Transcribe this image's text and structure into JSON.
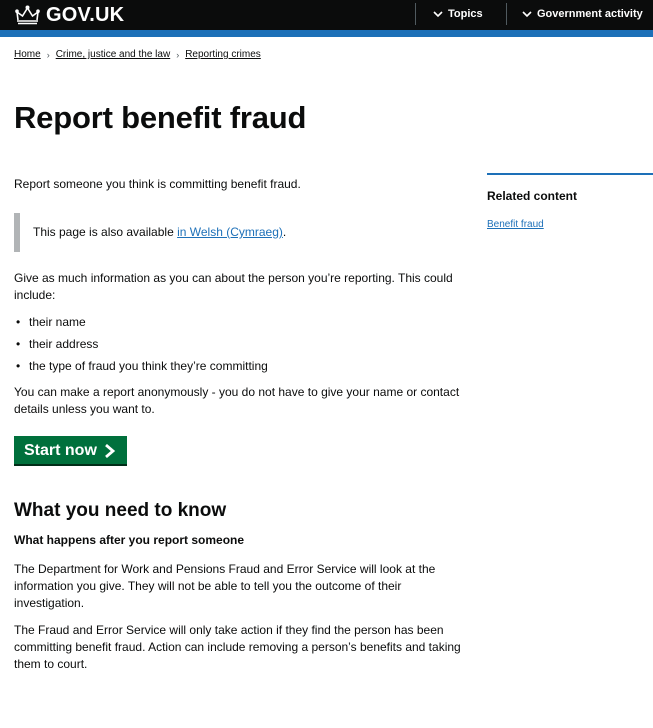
{
  "header": {
    "logo_text": "GOV.UK",
    "nav": [
      {
        "label": "Topics",
        "icon": "chevron-down-icon"
      },
      {
        "label": "Government activity",
        "icon": "chevron-down-icon"
      }
    ],
    "accent_color": "#1d70b8"
  },
  "breadcrumbs": [
    "Home",
    "Crime, justice and the law",
    "Reporting crimes"
  ],
  "page_title": "Report benefit fraud",
  "intro": "Report someone you think is committing benefit fraud.",
  "inset": {
    "text": "This page is also available ",
    "link": "in Welsh (Cymraeg)",
    "suffix": "."
  },
  "give_info": "Give as much information as you can about the person you’re reporting. This could include:",
  "bullets": [
    "their name",
    "their address",
    "the type of fraud you think they’re committing"
  ],
  "anonymous": "You can make a report anonymously - you do not have to give your name or contact details unless you want to.",
  "start_button": {
    "label": "Start now",
    "color": "#00703c"
  },
  "section_heading": "What you need to know",
  "sub_heading": "What happens after you report someone",
  "para1": "The Department for Work and Pensions Fraud and Error Service will look at the information you give. They will not be able to tell you the outcome of their investigation.",
  "para2": "The Fraud and Error Service will only take action if they find the person has been committing benefit fraud. Action can include removing a person’s benefits and taking them to court.",
  "related": {
    "heading": "Related content",
    "links": [
      "Benefit fraud"
    ]
  }
}
